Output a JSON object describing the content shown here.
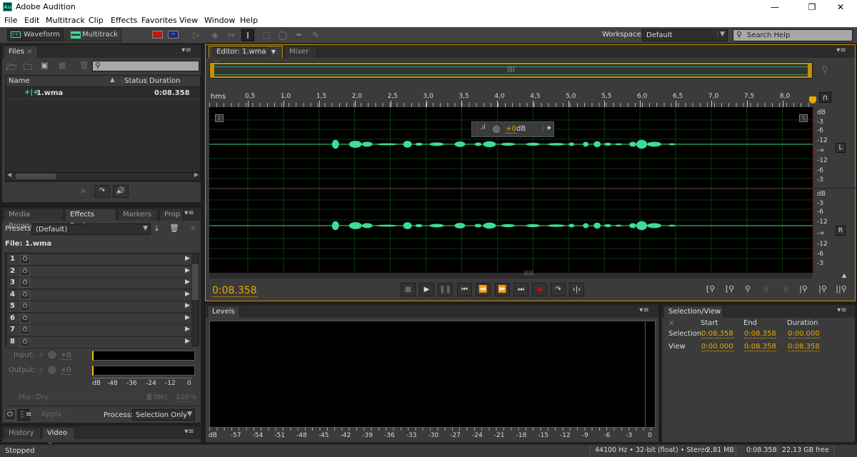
{
  "window": {
    "title": "Adobe Audition",
    "app_icon": "Au",
    "controls": [
      "minimize",
      "restore",
      "close"
    ]
  },
  "menu": [
    "File",
    "Edit",
    "Multitrack",
    "Clip",
    "Effects",
    "Favorites",
    "View",
    "Window",
    "Help"
  ],
  "toolbar": {
    "waveform_label": "Waveform",
    "multitrack_label": "Multitrack",
    "tools": [
      "spectral-frequency-icon",
      "spectral-pitch-icon",
      "move-tool-icon",
      "razor-tool-icon",
      "slip-tool-icon",
      "time-selection-tool-icon",
      "marquee-tool-icon",
      "lasso-tool-icon",
      "brush-tool-icon",
      "spot-healing-icon"
    ],
    "workspace_label": "Workspace:",
    "workspace_value": "Default",
    "search_placeholder": "Search Help"
  },
  "files_panel": {
    "tab": "Files",
    "columns": {
      "name": "Name",
      "status": "Status",
      "duration": "Duration"
    },
    "rows": [
      {
        "name": "1.wma",
        "status": "",
        "duration": "0:08.358"
      }
    ]
  },
  "effects_panel": {
    "tabs": [
      "Media Browser",
      "Effects Rack",
      "Markers",
      "Prop"
    ],
    "active_tab": "Effects Rack",
    "presets_label": "Presets:",
    "presets_value": "(Default)",
    "file_label": "File: 1.wma",
    "slots": [
      "1",
      "2",
      "3",
      "4",
      "5",
      "6",
      "7",
      "8"
    ],
    "input_label": "Input:",
    "input_value": "+0",
    "output_label": "Output:",
    "output_value": "+0",
    "meter_scale": [
      "dB",
      "-48",
      "-36",
      "-24",
      "-12",
      "0"
    ],
    "mix_label": "Mix:",
    "dry_label": "Dry",
    "wet_label": "Wet",
    "wet_value": "100",
    "wet_unit": "%",
    "apply_label": "Apply",
    "process_label": "Process:",
    "process_value": "Selection Only"
  },
  "bottom_left_tabs": [
    "History",
    "Video"
  ],
  "editor": {
    "tab": "Editor: 1.wma",
    "mixer_tab": "Mixer",
    "ruler_unit": "hms",
    "ruler_ticks": [
      "0,5",
      "1,0",
      "1,5",
      "2,0",
      "2,5",
      "3,0",
      "3,5",
      "4,0",
      "4,5",
      "5,0",
      "5,5",
      "6,0",
      "6,5",
      "7,0",
      "7,5",
      "8,0"
    ],
    "db_scale_top": [
      "dB",
      "-3",
      "-6",
      "-12",
      "-∞",
      "-12",
      "-6",
      "-3"
    ],
    "db_scale_bottom": [
      "dB",
      "-3",
      "-6",
      "-12",
      "-∞",
      "-12",
      "-6",
      "-3"
    ],
    "channel_left": "L",
    "channel_right": "R",
    "hud_gain": "+0",
    "hud_unit": "dB",
    "current_time": "0:08.358",
    "total_seconds": 8.358
  },
  "transport": [
    "stop",
    "play",
    "pause",
    "go-to-start",
    "rewind",
    "fast-forward",
    "go-to-end",
    "record",
    "loop",
    "skip-selection"
  ],
  "levels_panel": {
    "tab": "Levels",
    "scale": [
      "dB",
      "-57",
      "-54",
      "-51",
      "-48",
      "-45",
      "-42",
      "-39",
      "-36",
      "-33",
      "-30",
      "-27",
      "-24",
      "-21",
      "-18",
      "-15",
      "-12",
      "-9",
      "-6",
      "-3",
      "0"
    ]
  },
  "selection_view": {
    "tab": "Selection/View",
    "headers": [
      "Start",
      "End",
      "Duration"
    ],
    "selection_label": "Selection",
    "selection": [
      "0:08.358",
      "0:08.358",
      "0:00.000"
    ],
    "view_label": "View",
    "view": [
      "0:00.000",
      "0:08.358",
      "0:08.358"
    ]
  },
  "statusbar": {
    "state": "Stopped",
    "format": "44100 Hz • 32-bit (float) • Stereo",
    "size": "2,81 MB",
    "duration": "0:08.358",
    "free": "22,13 GB free"
  },
  "colors": {
    "accent": "#e8a800",
    "waveform": "#3ddc97",
    "bg": "#3b3b3b"
  }
}
